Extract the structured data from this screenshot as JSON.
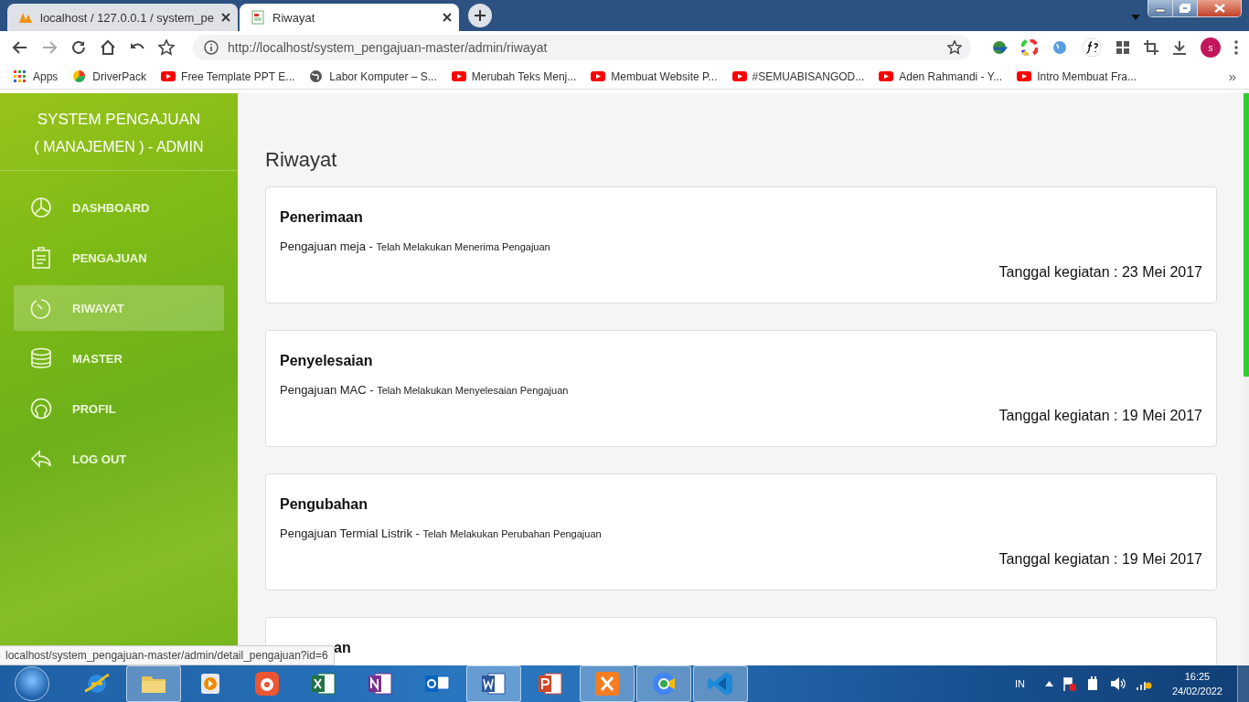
{
  "browser": {
    "tabs": [
      {
        "title": "localhost / 127.0.0.1 / system_pe",
        "selected": false
      },
      {
        "title": "Riwayat",
        "selected": true
      }
    ],
    "address": "http://localhost/system_pengajuan-master/admin/riwayat",
    "profile": "s",
    "bookmarks": [
      {
        "label": "Apps"
      },
      {
        "label": "DriverPack"
      },
      {
        "label": "Free Template PPT E..."
      },
      {
        "label": "Labor Komputer – S..."
      },
      {
        "label": "Merubah Teks Menj..."
      },
      {
        "label": "Membuat Website P..."
      },
      {
        "label": "#SEMUABISANGOD..."
      },
      {
        "label": "Aden Rahmandi - Y..."
      },
      {
        "label": "Intro Membuat Fra..."
      }
    ],
    "more_bookmarks": "»"
  },
  "sidebar": {
    "title": "SYSTEM PENGAJUAN",
    "subtitle": "( MANAJEMEN ) - ADMIN",
    "items": [
      {
        "label": "DASHBOARD",
        "selected": false
      },
      {
        "label": "PENGAJUAN",
        "selected": false
      },
      {
        "label": "RIWAYAT",
        "selected": true
      },
      {
        "label": "MASTER",
        "selected": false
      },
      {
        "label": "PROFIL",
        "selected": false
      },
      {
        "label": "LOG OUT",
        "selected": false
      }
    ]
  },
  "content": {
    "heading": "Riwayat",
    "cards": [
      {
        "title": "Penerimaan",
        "item": "Pengajuan meja - ",
        "action": "Telah Melakukan Menerima Pengajuan",
        "date": "Tanggal kegiatan : 23 Mei 2017",
        "covered": false
      },
      {
        "title": "Penyelesaian",
        "item": "Pengajuan MAC - ",
        "action": "Telah Melakukan Menyelesaian Pengajuan",
        "date": "Tanggal kegiatan : 19 Mei 2017",
        "covered": false
      },
      {
        "title": "Pengubahan",
        "item": "Pengajuan Termial Listrik - ",
        "action": "Telah Melakukan Perubahan Pengajuan",
        "date": "Tanggal kegiatan : 19 Mei 2017",
        "covered": false
      },
      {
        "title": "an",
        "covered": true
      }
    ]
  },
  "status_url": "localhost/system_pengajuan-master/admin/detail_pengajuan?id=6",
  "taskbar": {
    "language": "IN",
    "time": "16:25",
    "date": "24/02/2022",
    "apps": [
      {
        "selected": false
      },
      {
        "selected": true
      },
      {
        "selected": false
      },
      {
        "selected": false
      },
      {
        "selected": false
      },
      {
        "selected": false
      },
      {
        "selected": false
      },
      {
        "selected": true
      },
      {
        "selected": false
      },
      {
        "selected": true
      },
      {
        "selected": true
      },
      {
        "selected": true
      }
    ]
  }
}
